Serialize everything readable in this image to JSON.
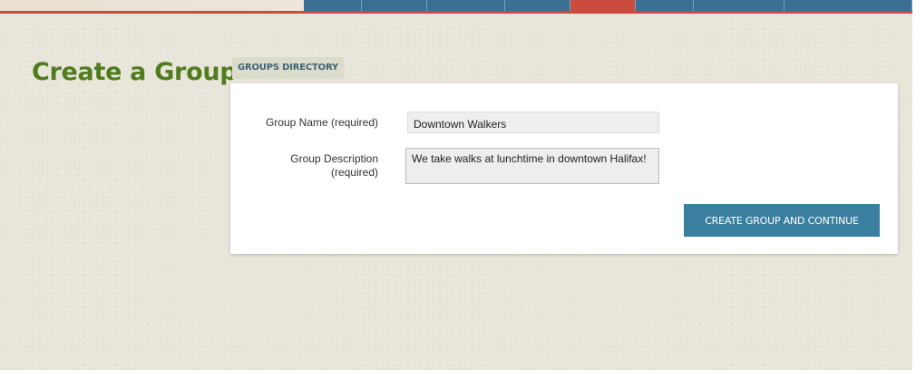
{
  "colors": {
    "title_green": "#4f7d1d",
    "nav_blue": "#3b6f93",
    "nav_red": "#cc4a3e",
    "button_blue": "#3a7fa0",
    "page_background": "#e8e5da"
  },
  "header": {
    "title": "Create a Group",
    "directory_link": "GROUPS DIRECTORY"
  },
  "form": {
    "group_name": {
      "label": "Group Name (required)",
      "value": "Downtown Walkers"
    },
    "group_description": {
      "label": "Group Description (required)",
      "value": "We take walks at lunchtime in downtown Halifax!"
    },
    "submit_label": "CREATE GROUP AND CONTINUE"
  }
}
